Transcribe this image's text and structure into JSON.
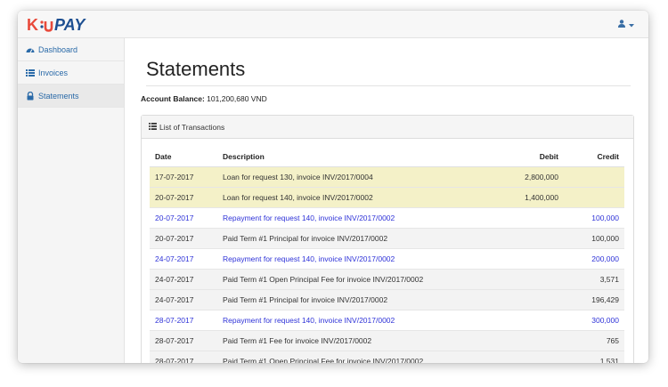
{
  "brand": {
    "logo_text_1": "K",
    "logo_text_2": "u",
    "logo_text_3": "PAY",
    "color_red": "#e84a3b",
    "color_blue": "#1d4f91"
  },
  "navbar": {
    "user_icon": "user-icon",
    "caret_icon": "caret-down-icon"
  },
  "sidebar": {
    "items": [
      {
        "label": "Dashboard",
        "icon": "dashboard-icon"
      },
      {
        "label": "Invoices",
        "icon": "list-icon"
      },
      {
        "label": "Statements",
        "icon": "lock-icon"
      }
    ]
  },
  "page": {
    "title": "Statements",
    "balance_label": "Account Balance:",
    "balance_value": "101,200,680 VND"
  },
  "panel": {
    "heading": "List of Transactions",
    "heading_icon": "list-icon"
  },
  "table": {
    "headers": {
      "date": "Date",
      "description": "Description",
      "debit": "Debit",
      "credit": "Credit"
    },
    "rows": [
      {
        "type": "loan",
        "date": "17-07-2017",
        "description": "Loan for request 130, invoice INV/2017/0004",
        "debit": "2,800,000",
        "credit": ""
      },
      {
        "type": "loan",
        "date": "20-07-2017",
        "description": "Loan for request 140, invoice INV/2017/0002",
        "debit": "1,400,000",
        "credit": ""
      },
      {
        "type": "repay",
        "date": "20-07-2017",
        "description": "Repayment for request 140, invoice INV/2017/0002",
        "debit": "",
        "credit": "100,000"
      },
      {
        "type": "paid",
        "date": "20-07-2017",
        "description": "Paid Term #1 Principal for invoice INV/2017/0002",
        "debit": "",
        "credit": "100,000"
      },
      {
        "type": "repay",
        "date": "24-07-2017",
        "description": "Repayment for request 140, invoice INV/2017/0002",
        "debit": "",
        "credit": "200,000"
      },
      {
        "type": "paid",
        "date": "24-07-2017",
        "description": "Paid Term #1 Open Principal Fee for invoice INV/2017/0002",
        "debit": "",
        "credit": "3,571"
      },
      {
        "type": "paid",
        "date": "24-07-2017",
        "description": "Paid Term #1 Principal for invoice INV/2017/0002",
        "debit": "",
        "credit": "196,429"
      },
      {
        "type": "repay",
        "date": "28-07-2017",
        "description": "Repayment for request 140, invoice INV/2017/0002",
        "debit": "",
        "credit": "300,000"
      },
      {
        "type": "paid",
        "date": "28-07-2017",
        "description": "Paid Term #1 Fee for invoice INV/2017/0002",
        "debit": "",
        "credit": "765"
      },
      {
        "type": "paid",
        "date": "28-07-2017",
        "description": "Paid Term #1 Open Principal Fee for invoice INV/2017/0002",
        "debit": "",
        "credit": "1,531"
      }
    ]
  }
}
